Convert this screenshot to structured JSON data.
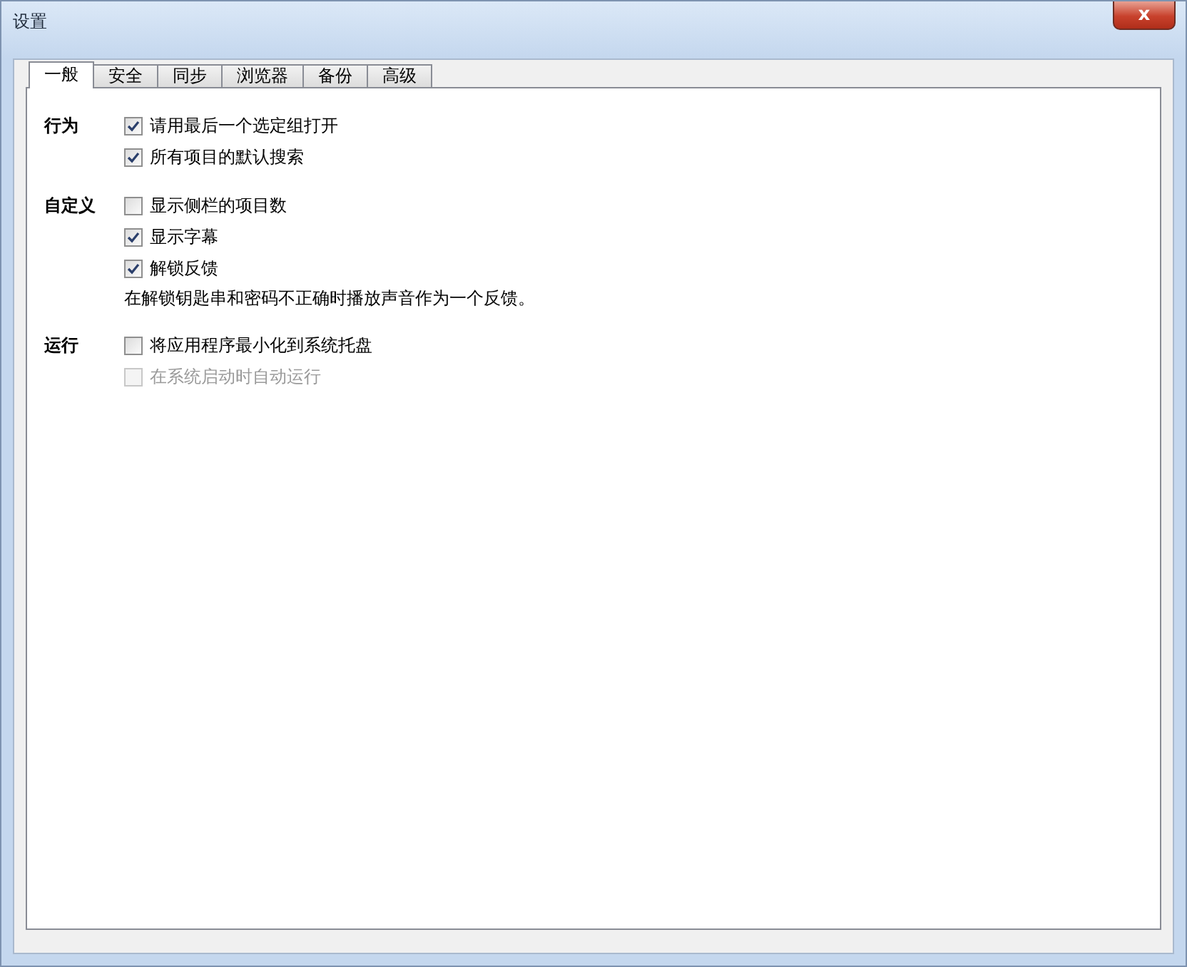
{
  "window": {
    "title": "设置",
    "close": "x"
  },
  "tabs": [
    {
      "label": "一般",
      "selected": true
    },
    {
      "label": "安全",
      "selected": false
    },
    {
      "label": "同步",
      "selected": false
    },
    {
      "label": "浏览器",
      "selected": false
    },
    {
      "label": "备份",
      "selected": false
    },
    {
      "label": "高级",
      "selected": false
    }
  ],
  "sections": [
    {
      "title": "行为",
      "items": [
        {
          "kind": "checkbox",
          "label": "请用最后一个选定组打开",
          "checked": true,
          "disabled": false
        },
        {
          "kind": "checkbox",
          "label": "所有项目的默认搜索",
          "checked": true,
          "disabled": false
        }
      ]
    },
    {
      "title": "自定义",
      "items": [
        {
          "kind": "checkbox",
          "label": "显示侧栏的项目数",
          "checked": false,
          "disabled": false
        },
        {
          "kind": "checkbox",
          "label": "显示字幕",
          "checked": true,
          "disabled": false
        },
        {
          "kind": "checkbox",
          "label": "解锁反馈",
          "checked": true,
          "disabled": false
        },
        {
          "kind": "note",
          "label": "在解锁钥匙串和密码不正确时播放声音作为一个反馈。"
        }
      ]
    },
    {
      "title": "运行",
      "items": [
        {
          "kind": "checkbox",
          "label": "将应用程序最小化到系统托盘",
          "checked": false,
          "disabled": false
        },
        {
          "kind": "checkbox",
          "label": "在系统启动时自动运行",
          "checked": false,
          "disabled": true
        }
      ]
    }
  ]
}
